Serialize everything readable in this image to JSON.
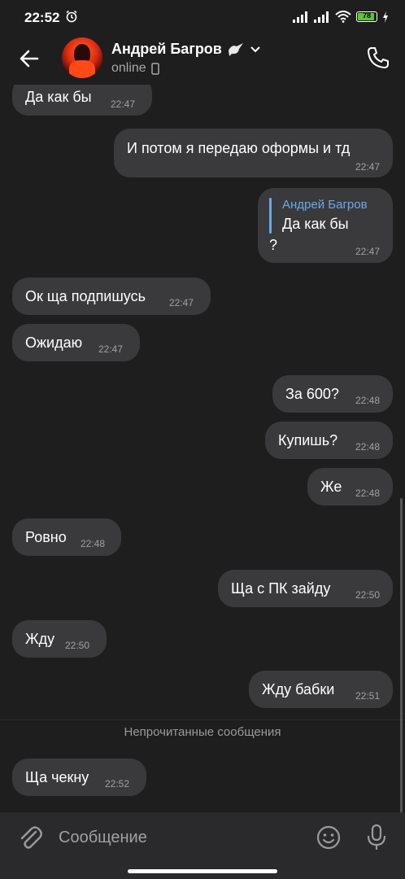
{
  "status_bar": {
    "time": "22:52",
    "battery": "78"
  },
  "header": {
    "contact_name": "Андрей Багров",
    "contact_status": "online"
  },
  "messages": [
    {
      "text": "Да как бы",
      "time": "22:47",
      "side": "in"
    },
    {
      "text": "И потом я передаю оформы и тд",
      "time": "22:47",
      "side": "out"
    },
    {
      "reply_author": "Андрей Багров",
      "reply_text": "Да как бы",
      "text": "?",
      "time": "22:47",
      "side": "out"
    },
    {
      "text": "Ок ща подпишусь",
      "time": "22:47",
      "side": "in"
    },
    {
      "text": "Ожидаю",
      "time": "22:47",
      "side": "in"
    },
    {
      "text": "За 600?",
      "time": "22:48",
      "side": "out"
    },
    {
      "text": "Купишь?",
      "time": "22:48",
      "side": "out"
    },
    {
      "text": "Же",
      "time": "22:48",
      "side": "out"
    },
    {
      "text": "Ровно",
      "time": "22:48",
      "side": "in"
    },
    {
      "text": "Ща с ПК зайду",
      "time": "22:50",
      "side": "out"
    },
    {
      "text": "Жду",
      "time": "22:50",
      "side": "in"
    },
    {
      "text": "Жду бабки",
      "time": "22:51",
      "side": "out"
    },
    {
      "text": "Ща чекну",
      "time": "22:52",
      "side": "in"
    }
  ],
  "unread_divider": "Непрочитанные сообщения",
  "composer": {
    "placeholder": "Сообщение"
  },
  "colors": {
    "background": "#1e1e1e",
    "bubble": "#3a3a3c",
    "accent": "#6aa9e8",
    "battery": "#5ec23a"
  }
}
